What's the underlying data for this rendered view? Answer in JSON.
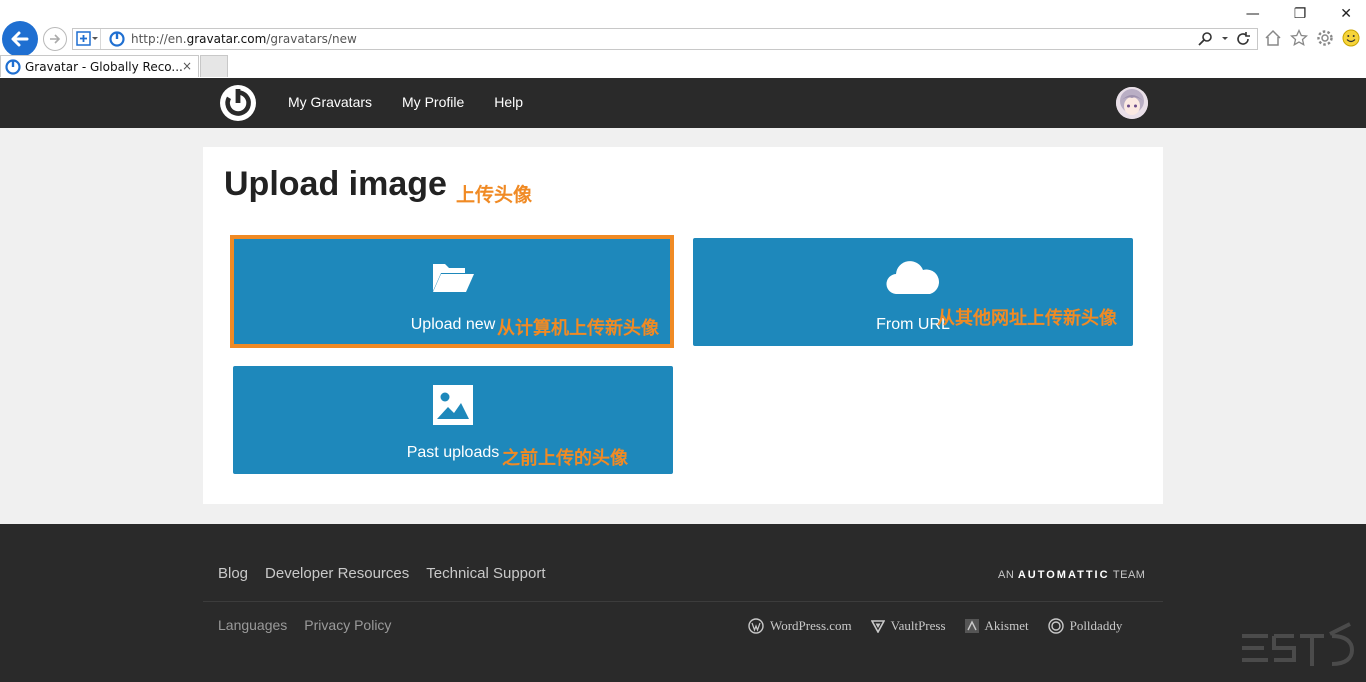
{
  "browser": {
    "url_prefix": "http://en.",
    "url_domain": "gravatar.com",
    "url_path": "/gravatars/new",
    "tab_title": "Gravatar - Globally Reco...",
    "tab_close": "×",
    "window_controls": [
      "—",
      "❐",
      "✕"
    ]
  },
  "nav": {
    "links": [
      "My Gravatars",
      "My Profile",
      "Help"
    ]
  },
  "main": {
    "title": "Upload image",
    "title_annotation": "上传头像",
    "tiles": [
      {
        "label": "Upload new",
        "annotation": "从计算机上传新头像",
        "icon": "folder-open-icon"
      },
      {
        "label": "From URL",
        "annotation": "从其他网址上传新头像",
        "icon": "cloud-icon"
      },
      {
        "label": "Past uploads",
        "annotation": "之前上传的头像",
        "icon": "image-icon"
      }
    ]
  },
  "footer": {
    "links": [
      "Blog",
      "Developer Resources",
      "Technical Support"
    ],
    "brand_prefix": "AN",
    "brand_name": "AUTOMATTIC",
    "brand_suffix": "TEAM",
    "secondary_links": [
      "Languages",
      "Privacy Policy"
    ],
    "partners": [
      "WordPress.com",
      "VaultPress",
      "Akismet",
      "Polldaddy"
    ]
  },
  "colors": {
    "accent": "#1e88bb",
    "annotation": "#f08a24",
    "nav_bg": "#2a2a2a"
  }
}
